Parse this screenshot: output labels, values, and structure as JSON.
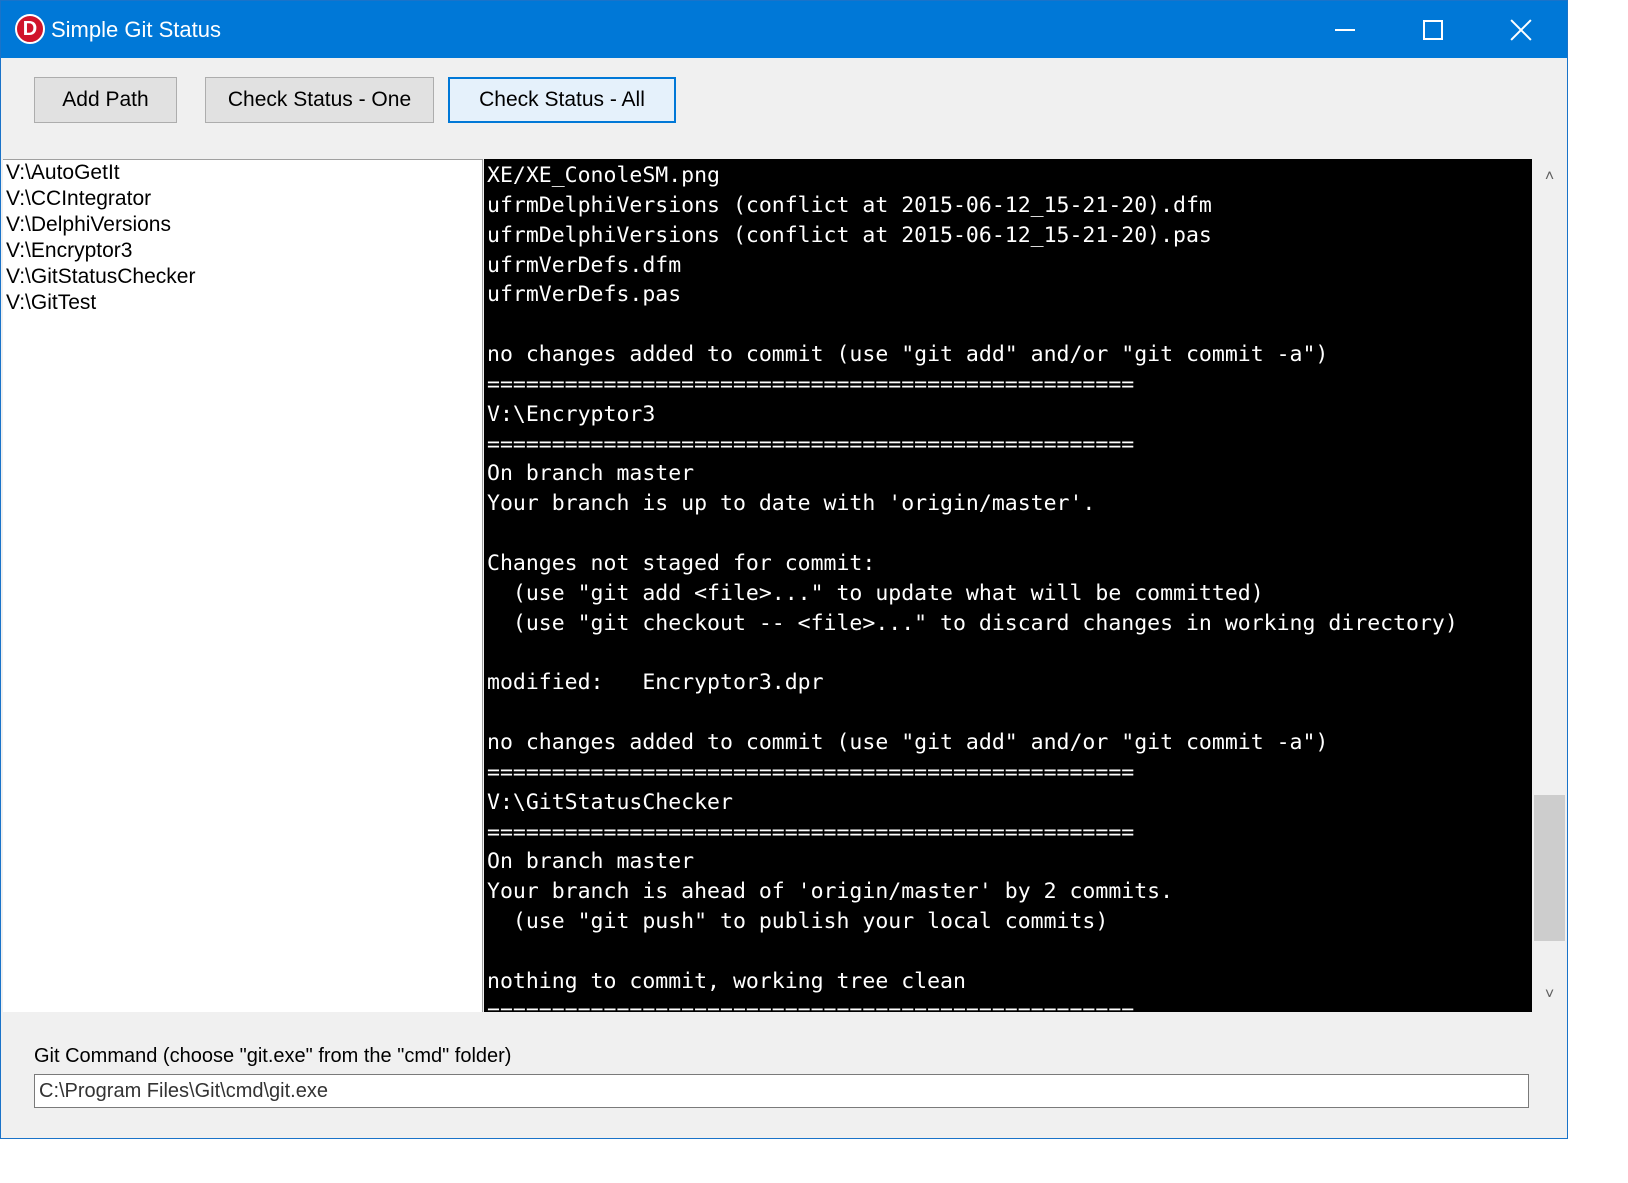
{
  "window": {
    "title": "Simple Git Status",
    "icon_letter": "D"
  },
  "toolbar": {
    "add_path_label": "Add Path",
    "check_one_label": "Check Status - One",
    "check_all_label": "Check Status - All"
  },
  "paths": [
    "V:\\AutoGetIt",
    "V:\\CCIntegrator",
    "V:\\DelphiVersions",
    "V:\\Encryptor3",
    "V:\\GitStatusChecker",
    "V:\\GitTest"
  ],
  "console": {
    "lines": [
      "XE/XE_ConoleSM.png",
      "ufrmDelphiVersions (conflict at 2015-06-12_15-21-20).dfm",
      "ufrmDelphiVersions (conflict at 2015-06-12_15-21-20).pas",
      "ufrmVerDefs.dfm",
      "ufrmVerDefs.pas",
      "",
      "no changes added to commit (use \"git add\" and/or \"git commit -a\")",
      "==================================================",
      "V:\\Encryptor3",
      "==================================================",
      "On branch master",
      "Your branch is up to date with 'origin/master'.",
      "",
      "Changes not staged for commit:",
      "  (use \"git add <file>...\" to update what will be committed)",
      "  (use \"git checkout -- <file>...\" to discard changes in working directory)",
      "",
      "modified:   Encryptor3.dpr",
      "",
      "no changes added to commit (use \"git add\" and/or \"git commit -a\")",
      "==================================================",
      "V:\\GitStatusChecker",
      "==================================================",
      "On branch master",
      "Your branch is ahead of 'origin/master' by 2 commits.",
      "  (use \"git push\" to publish your local commits)",
      "",
      "nothing to commit, working tree clean",
      "=================================================="
    ]
  },
  "git_command": {
    "label": "Git Command (choose \"git.exe\" from the \"cmd\" folder)",
    "value": "C:\\Program Files\\Git\\cmd\\git.exe"
  },
  "colors": {
    "titlebar": "#0078d7",
    "console_bg": "#000000",
    "console_fg": "#ffffff"
  }
}
